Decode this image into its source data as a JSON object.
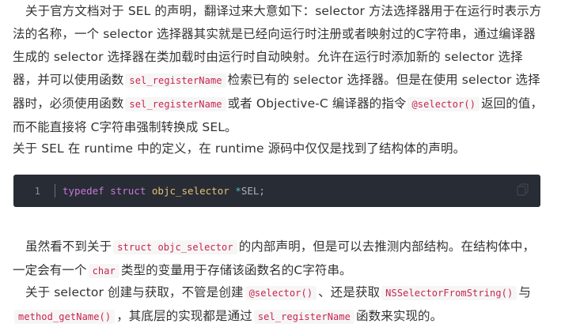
{
  "p1": {
    "t1": "关于官方文档对于 SEL 的声明，翻译过来大意如下：selector 方法选择器用于在运行时表示方法的名称，一个 selector 选择器其实就是已经向运行时注册或者映射过的C字符串，通过编译器生成的 selector 选择器在类加载时由运行时自动映射。允许在运行时添加新的 selector 选择器，并可以使用函数",
    "c1": "sel_registerName",
    "t2": "检索已有的 selector 选择器。但是在使用 selector 选择器时，必须使用函数",
    "c2": "sel_registerName",
    "t3": "或者 Objective-C 编译器的指令",
    "c3": "@selector()",
    "t4": "返回的值，而不能直接将 C字符串强制转换成 SEL。"
  },
  "p2": {
    "t1": "关于 SEL 在 runtime 中的定义，在 runtime 源码中仅仅是找到了结构体的声明。"
  },
  "codeblock": {
    "line_number": "1",
    "kw_typedef": "typedef",
    "kw_struct": "struct",
    "type_name": "objc_selector",
    "op": "*",
    "rest": "SEL;"
  },
  "p3": {
    "t1": "虽然看不到关于",
    "c1": "struct objc_selector",
    "t2": "的内部声明，但是可以去推测内部结构。在结构体中，一定会有一个",
    "c2": "char",
    "t3": "类型的变量用于存储该函数名的C字符串。"
  },
  "p4": {
    "t1": "关于 selector 创建与获取，不管是创建",
    "c1": "@selector()",
    "t2": "、还是获取",
    "c2": "NSSelectorFromString()",
    "t3": "与",
    "c3": "method_getName()",
    "t4": "，其底层的实现都是通过",
    "c4": "sel_registerName",
    "t5": "函数来实现的。"
  },
  "colors": {
    "code_bg": "#282c34",
    "inline_code": "#c7254e",
    "keyword": "#c678dd",
    "type": "#e5c07b"
  },
  "icons": {
    "copy": "copy-icon"
  }
}
